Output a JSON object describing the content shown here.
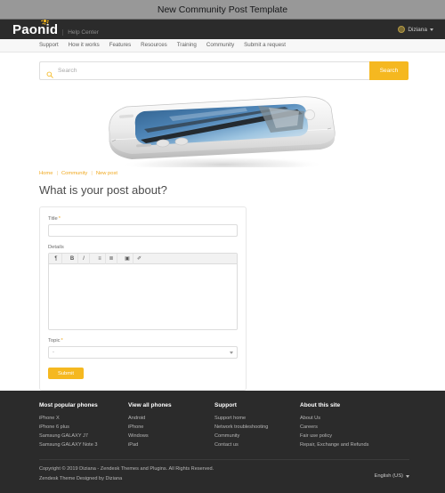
{
  "window": {
    "title": "New Community Post Template"
  },
  "header": {
    "logo_text": "Paonid",
    "logo_icon": "gear-icon",
    "subtitle": "Help Center",
    "user": {
      "name": "Diziana",
      "avatar_icon": "user-avatar-icon",
      "caret_icon": "chevron-down-icon"
    }
  },
  "nav": {
    "items": [
      {
        "label": "Support"
      },
      {
        "label": "How it works"
      },
      {
        "label": "Features"
      },
      {
        "label": "Resources"
      },
      {
        "label": "Training"
      },
      {
        "label": "Community"
      },
      {
        "label": "Submit a request"
      }
    ]
  },
  "search": {
    "placeholder": "Search",
    "value": "",
    "button_label": "Search",
    "icon": "search-icon"
  },
  "hero": {
    "alt": "white smartphone lying on its side with blue sky screen"
  },
  "breadcrumb": {
    "items": [
      {
        "label": "Home"
      },
      {
        "label": "Community"
      },
      {
        "label": "New post"
      }
    ],
    "separator": "|"
  },
  "main": {
    "title": "What is your post about?",
    "form": {
      "title_field": {
        "label": "Title",
        "required_marker": "*",
        "value": "",
        "placeholder": ""
      },
      "details_field": {
        "label": "Details",
        "value": ""
      },
      "toolbar": [
        {
          "name": "paragraph-icon",
          "glyph": "¶"
        },
        {
          "name": "bold-icon",
          "glyph": "B"
        },
        {
          "name": "italic-icon",
          "glyph": "I"
        },
        {
          "name": "unordered-list-icon",
          "glyph": "≡"
        },
        {
          "name": "ordered-list-icon",
          "glyph": "≣"
        },
        {
          "name": "insert-image-icon",
          "glyph": "▣"
        },
        {
          "name": "insert-link-icon",
          "glyph": "✐"
        }
      ],
      "topic_field": {
        "label": "Topic",
        "required_marker": "*",
        "value": "-"
      },
      "submit_label": "Submit"
    }
  },
  "footer": {
    "columns": [
      {
        "heading": "Most popular phones",
        "links": [
          {
            "label": "iPhone X"
          },
          {
            "label": "iPhone 6 plus"
          },
          {
            "label": "Samsung GALAXY J7"
          },
          {
            "label": "Samsung GALAXY Note 3"
          }
        ]
      },
      {
        "heading": "View all phones",
        "links": [
          {
            "label": "Android"
          },
          {
            "label": "iPhone"
          },
          {
            "label": "Windows"
          },
          {
            "label": "iPad"
          }
        ]
      },
      {
        "heading": "Support",
        "links": [
          {
            "label": "Support home"
          },
          {
            "label": "Network troubleshooting"
          },
          {
            "label": "Community"
          },
          {
            "label": "Contact us"
          }
        ]
      },
      {
        "heading": "About this site",
        "links": [
          {
            "label": "About Us"
          },
          {
            "label": "Careers"
          },
          {
            "label": "Fair use policy"
          },
          {
            "label": "Repair, Exchange and Refunds"
          }
        ]
      }
    ],
    "copyright_line_1": "Copyright © 2019 Diziana - Zendesk Themes and Plugins. All Rights Reserved.",
    "copyright_line_2": "Zendesk Theme Designed by Diziana",
    "language": {
      "label": "English (US)",
      "caret_icon": "chevron-down-icon"
    }
  },
  "colors": {
    "accent": "#f5b820",
    "header_bg": "#2b2b2b",
    "breadcrumb_link": "#f0a81e",
    "titlebar_bg": "#989898"
  }
}
